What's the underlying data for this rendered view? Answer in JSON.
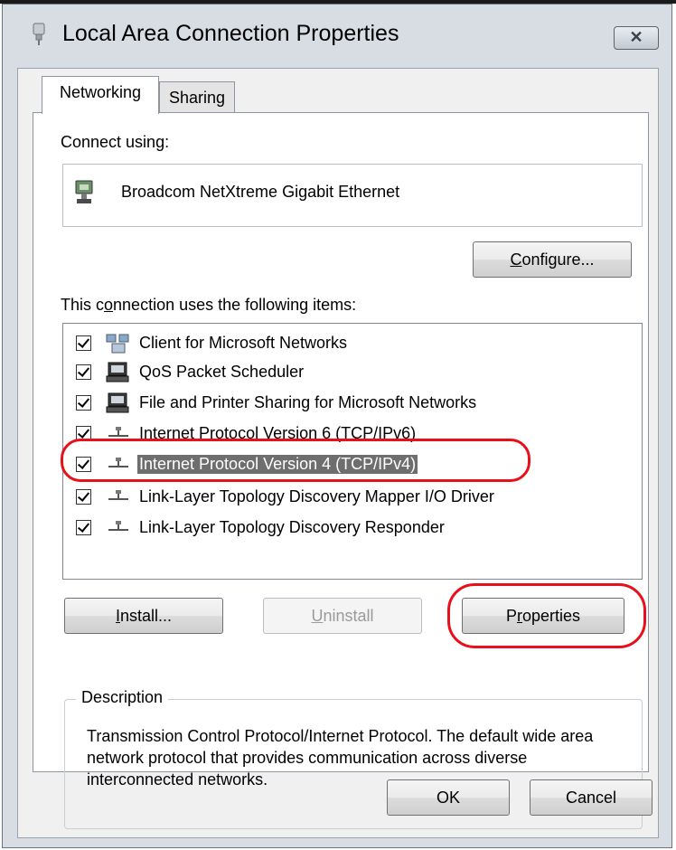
{
  "window": {
    "title": "Local Area Connection Properties",
    "close_label": "✕"
  },
  "tabs": [
    {
      "label": "Networking",
      "active": true
    },
    {
      "label": "Sharing",
      "active": false
    }
  ],
  "connect_using": {
    "label": "Connect using:",
    "adapter": "Broadcom NetXtreme Gigabit Ethernet"
  },
  "configure_button": {
    "pre": "",
    "accel": "C",
    "post": "onfigure..."
  },
  "items_label": {
    "pre": "This c",
    "accel": "o",
    "post": "nnection uses the following items:"
  },
  "items": [
    {
      "label": "Client for Microsoft Networks",
      "checked": true,
      "icon": "network-client-icon"
    },
    {
      "label": "QoS Packet Scheduler",
      "checked": true,
      "icon": "computer-icon"
    },
    {
      "label": "File and Printer Sharing for Microsoft Networks",
      "checked": true,
      "icon": "computer-icon"
    },
    {
      "label": "Internet Protocol Version 6 (TCP/IPv6)",
      "checked": true,
      "icon": "protocol-icon"
    },
    {
      "label": "Internet Protocol Version 4 (TCP/IPv4)",
      "checked": true,
      "icon": "protocol-icon",
      "selected": true
    },
    {
      "label": "Link-Layer Topology Discovery Mapper I/O Driver",
      "checked": true,
      "icon": "protocol-icon"
    },
    {
      "label": "Link-Layer Topology Discovery Responder",
      "checked": true,
      "icon": "protocol-icon"
    }
  ],
  "buttons": {
    "install": {
      "pre": "",
      "accel": "I",
      "post": "nstall..."
    },
    "uninstall": {
      "pre": "",
      "accel": "U",
      "post": "ninstall"
    },
    "properties": {
      "pre": "P",
      "accel": "r",
      "post": "operties"
    }
  },
  "description": {
    "legend": "Description",
    "text": "Transmission Control Protocol/Internet Protocol. The default wide area network protocol that provides communication across diverse interconnected networks."
  },
  "footer": {
    "ok_label": "OK",
    "cancel_label": "Cancel"
  },
  "colors": {
    "highlight_oval": "#e8101a",
    "selection_bg": "#6e6e6e"
  }
}
